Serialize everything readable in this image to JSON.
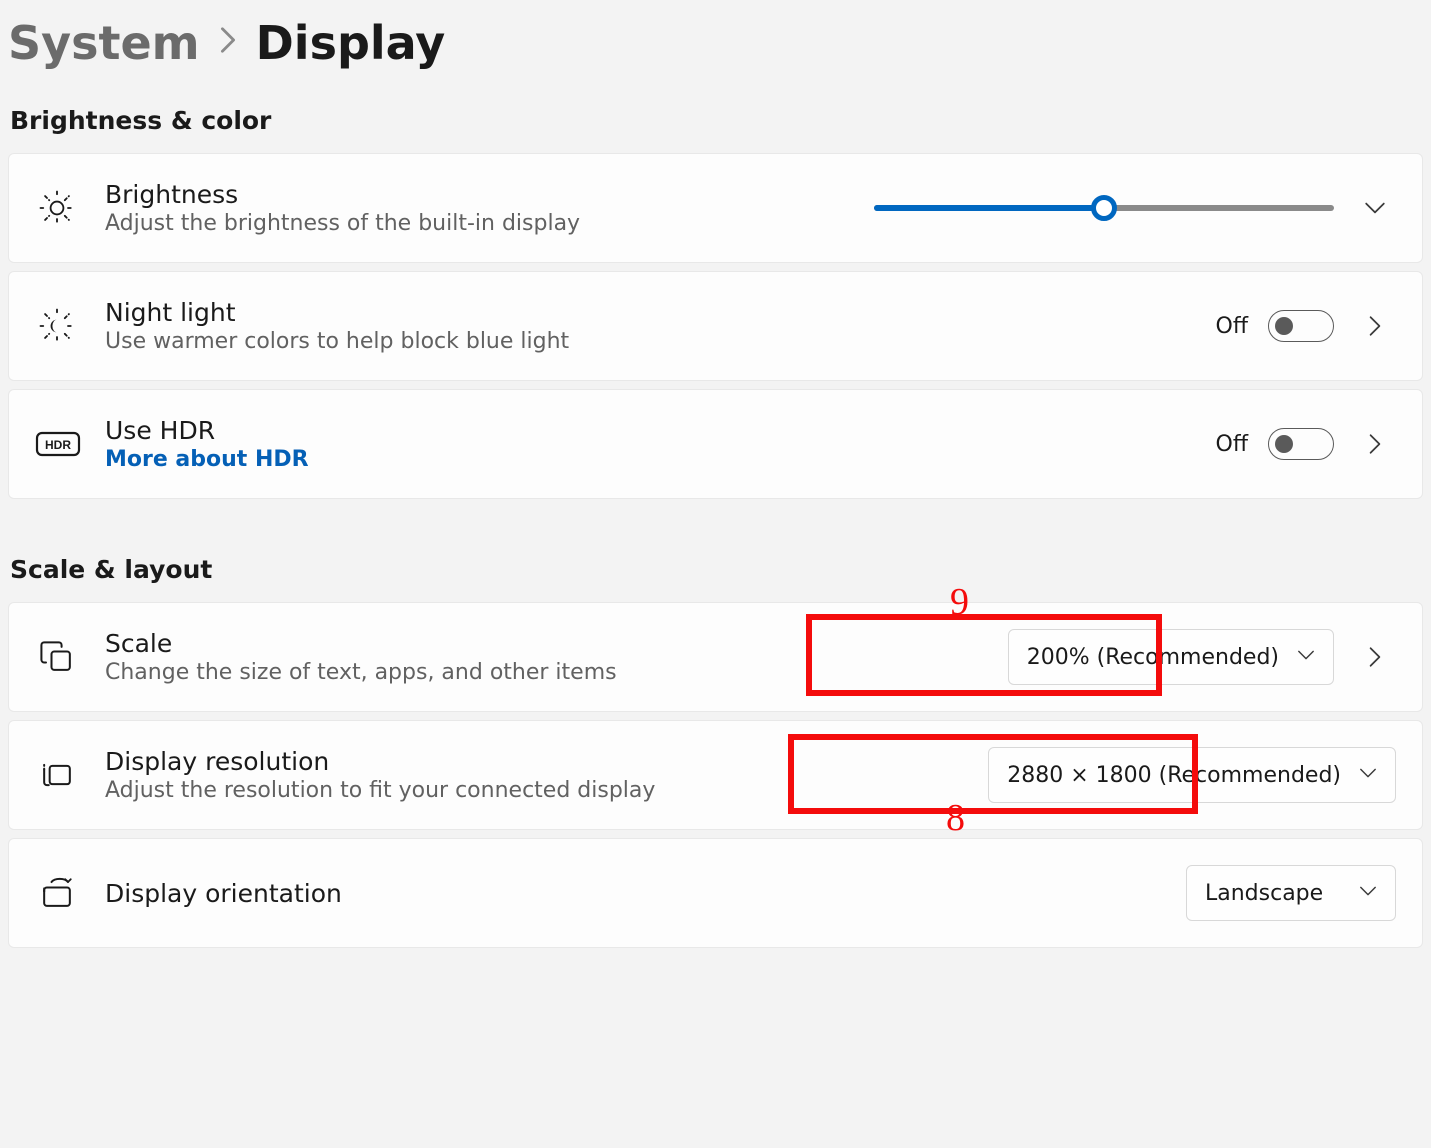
{
  "breadcrumb": {
    "parent": "System",
    "current": "Display"
  },
  "sections": {
    "brightness_color": {
      "title": "Brightness & color",
      "rows": {
        "brightness": {
          "title": "Brightness",
          "sub": "Adjust the brightness of the built-in display"
        },
        "night_light": {
          "title": "Night light",
          "sub": "Use warmer colors to help block blue light",
          "state_label": "Off"
        },
        "hdr": {
          "title": "Use HDR",
          "link": "More about HDR",
          "state_label": "Off"
        }
      }
    },
    "scale_layout": {
      "title": "Scale & layout",
      "rows": {
        "scale": {
          "title": "Scale",
          "sub": "Change the size of text, apps, and other items",
          "value": "200% (Recommended)"
        },
        "resolution": {
          "title": "Display resolution",
          "sub": "Adjust the resolution to fit your connected display",
          "value": "2880 × 1800 (Recommended)"
        },
        "orientation": {
          "title": "Display orientation",
          "value": "Landscape"
        }
      }
    }
  },
  "annotations": {
    "scale_box_label": "9",
    "resolution_box_label": "8"
  }
}
